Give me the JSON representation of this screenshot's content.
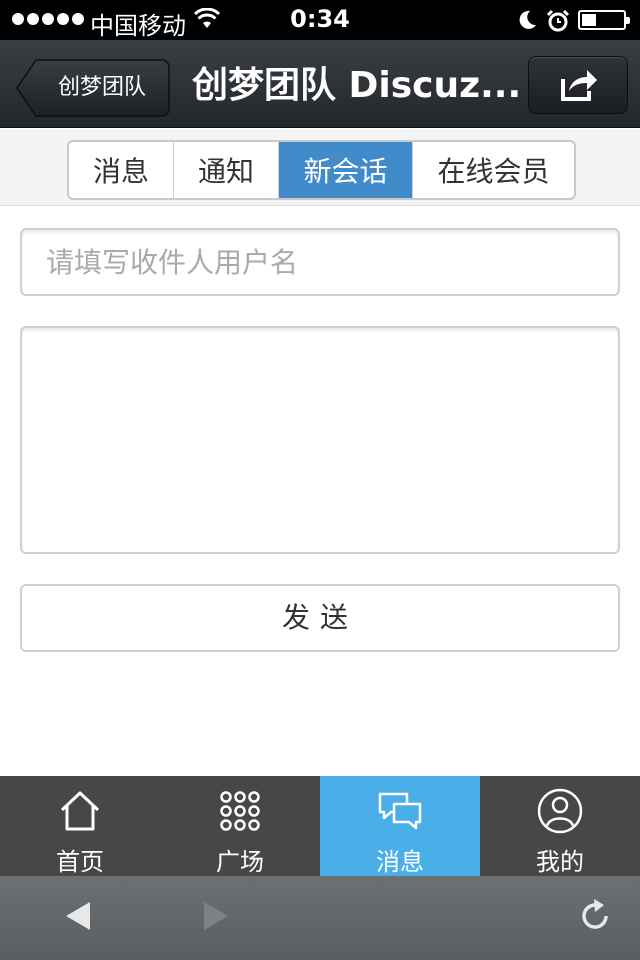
{
  "status_bar": {
    "carrier": "中国移动",
    "time": "0:34"
  },
  "header": {
    "back_label": "创梦团队",
    "title": "创梦团队 Discuz..."
  },
  "segments": [
    {
      "label": "消息",
      "active": false
    },
    {
      "label": "通知",
      "active": false
    },
    {
      "label": "新会话",
      "active": true
    },
    {
      "label": "在线会员",
      "active": false
    }
  ],
  "form": {
    "recipient_placeholder": "请填写收件人用户名",
    "recipient_value": "",
    "message_value": "",
    "send_label": "发送"
  },
  "tabbar": [
    {
      "label": "首页",
      "icon": "home-icon",
      "active": false
    },
    {
      "label": "广场",
      "icon": "grid-icon",
      "active": false
    },
    {
      "label": "消息",
      "icon": "chat-icon",
      "active": true
    },
    {
      "label": "我的",
      "icon": "user-icon",
      "active": false
    }
  ],
  "colors": {
    "active_segment": "#428bca",
    "active_tab": "#4aaee8",
    "tabbar_bg": "#474747",
    "header_bg": "#2c3034"
  }
}
